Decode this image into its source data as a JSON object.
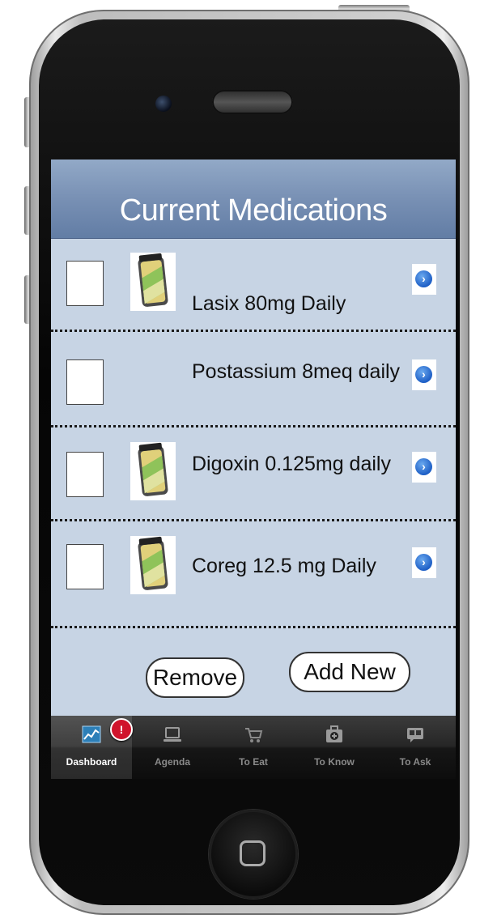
{
  "navbar": {
    "title": "Current Medications"
  },
  "medications": [
    {
      "label": "Lasix 80mg Daily",
      "has_icon": true
    },
    {
      "label": "Postassium 8meq daily",
      "has_icon": false
    },
    {
      "label": "Digoxin 0.125mg daily",
      "has_icon": true
    },
    {
      "label": "Coreg 12.5 mg Daily",
      "has_icon": true
    }
  ],
  "actions": {
    "remove_label": "Remove",
    "add_label": "Add New"
  },
  "tabbar": {
    "badge": "!",
    "tabs": [
      {
        "label": "Dashboard",
        "icon": "chart-icon",
        "active": true
      },
      {
        "label": "Agenda",
        "icon": "laptop-icon",
        "active": false
      },
      {
        "label": "To Eat",
        "icon": "cart-icon",
        "active": false
      },
      {
        "label": "To Know",
        "icon": "medkit-icon",
        "active": false
      },
      {
        "label": "To Ask",
        "icon": "chat-icon",
        "active": false
      }
    ]
  },
  "colors": {
    "navbar": "#7890b4",
    "screen_bg": "#c7d4e4",
    "badge": "#d0142c",
    "disclosure": "#1e5fc6"
  }
}
